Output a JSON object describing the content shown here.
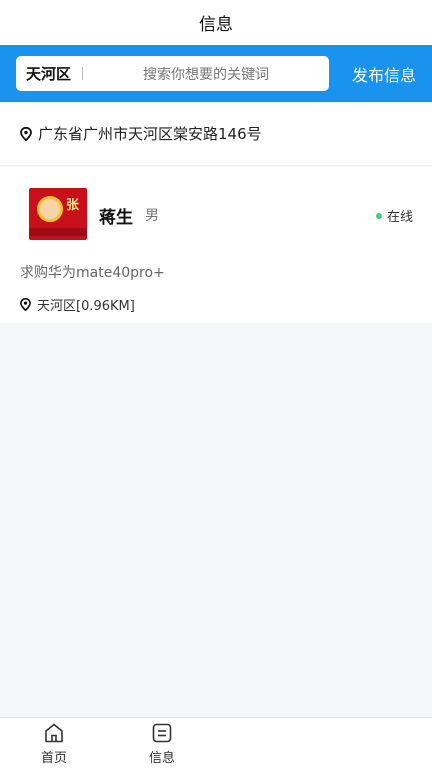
{
  "header": {
    "title": "信息"
  },
  "search": {
    "district": "天河区",
    "placeholder": "搜索你想要的关键词",
    "publish_label": "发布信息"
  },
  "location": {
    "address": "广东省广州市天河区棠安路146号",
    "icon": "location-pin-icon"
  },
  "posts": [
    {
      "name": "蒋生",
      "gender": "男",
      "status": "在线",
      "status_color": "#3ecf6e",
      "content": "求购华为mate40pro+",
      "location": "天河区[0.96KM]",
      "avatar_text": "张"
    }
  ],
  "tabbar": {
    "items": [
      {
        "label": "首页",
        "icon": "home-icon"
      },
      {
        "label": "信息",
        "icon": "message-icon"
      }
    ]
  },
  "colors": {
    "brand": "#1a93ee",
    "online": "#3ecf6e"
  }
}
